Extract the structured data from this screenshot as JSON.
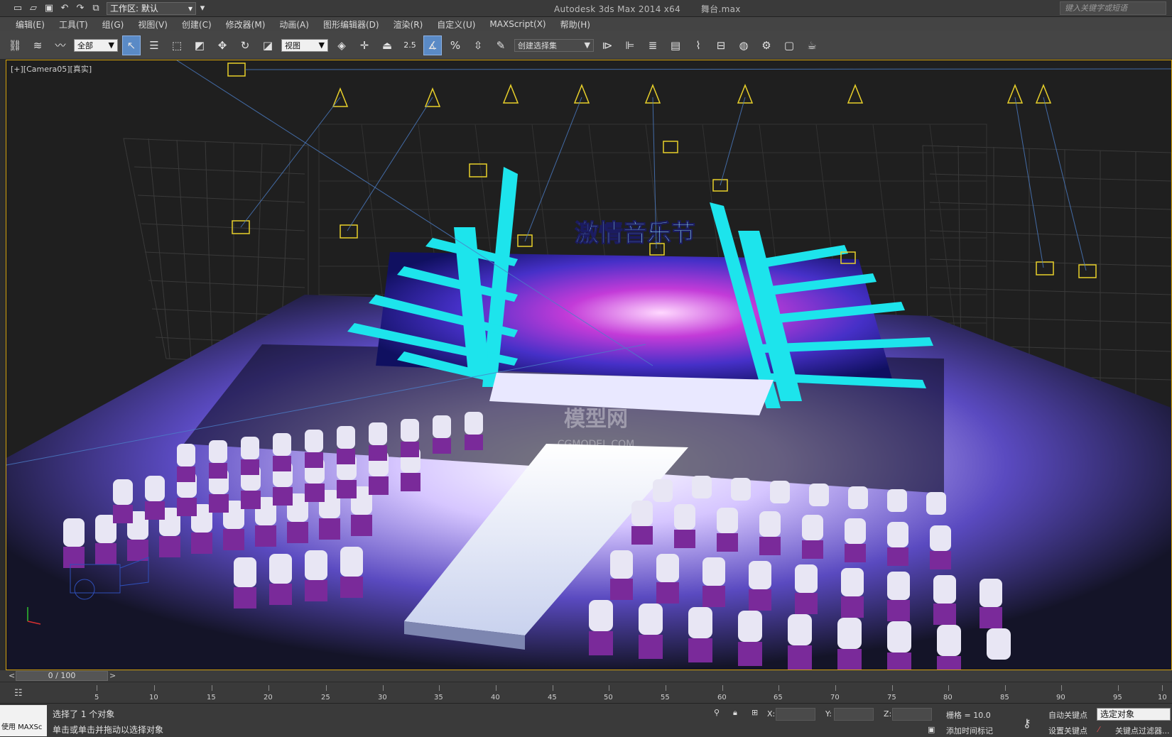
{
  "titlebar": {
    "workspace_label": "工作区: 默认",
    "app_title": "Autodesk 3ds Max  2014 x64",
    "file_name": "舞台.max",
    "search_placeholder": "键入关键字或短语"
  },
  "menu": [
    "编辑(E)",
    "工具(T)",
    "组(G)",
    "视图(V)",
    "创建(C)",
    "修改器(M)",
    "动画(A)",
    "图形编辑器(D)",
    "渲染(R)",
    "自定义(U)",
    "MAXScript(X)",
    "帮助(H)"
  ],
  "toolbar": {
    "selection_filter": "全部",
    "reference_coord": "视图",
    "snap_angle": "2.5",
    "named_selection": "创建选择集"
  },
  "viewport": {
    "label": "[+][Camera05][真实]",
    "stage_title": "激情音乐节",
    "watermark_cn": "模型网",
    "watermark_en": "CGMODEL.COM"
  },
  "timeline": {
    "frame_display": "0 / 100",
    "prev": "<",
    "next": ">",
    "ticks": [
      "5",
      "10",
      "15",
      "20",
      "25",
      "30",
      "35",
      "40",
      "45",
      "50",
      "55",
      "60",
      "65",
      "70",
      "75",
      "80",
      "85",
      "90",
      "95",
      "10"
    ]
  },
  "status": {
    "script_label": "使用 MAXSc",
    "selection_text": "选择了 1 个对象",
    "prompt_text": "单击或单击并拖动以选择对象",
    "x_label": "X:",
    "y_label": "Y:",
    "z_label": "Z:",
    "grid_text": "栅格 = 10.0",
    "add_time_tag": "添加时间标记",
    "auto_key": "自动关键点",
    "set_key": "设置关键点",
    "selected_object": "选定对象",
    "key_filter": "关键点过滤器..."
  }
}
